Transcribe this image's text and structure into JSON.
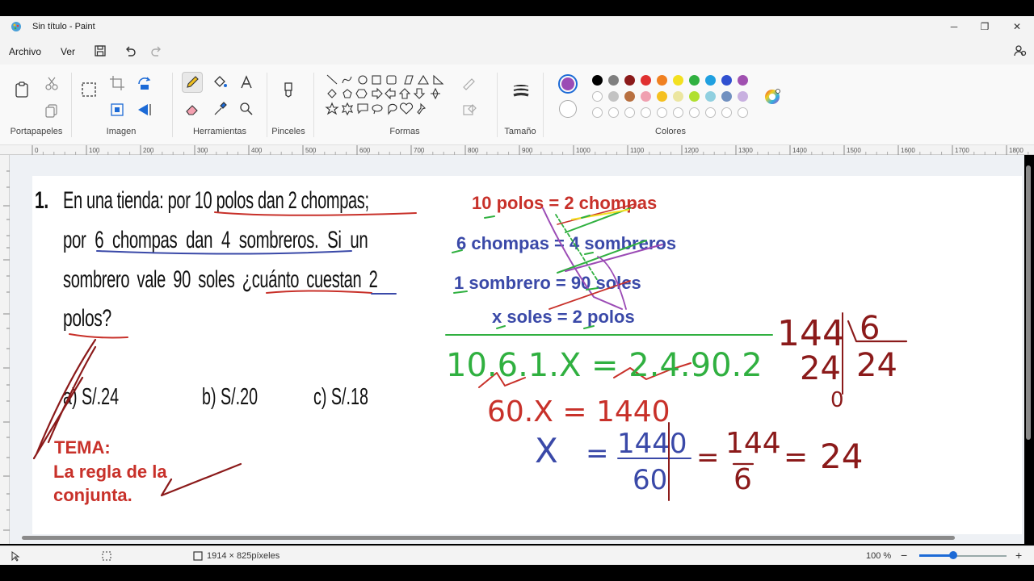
{
  "window": {
    "title": "Sin título - Paint"
  },
  "menu": {
    "file": "Archivo",
    "view": "Ver"
  },
  "ribbon": {
    "groups": [
      "Portapapeles",
      "Imagen",
      "Herramientas",
      "Pinceles",
      "Formas",
      "Tamaño",
      "Colores"
    ]
  },
  "colors": {
    "primary": "#9b4bb5",
    "palette_row1": [
      "#000000",
      "#7f7f7f",
      "#8b1a1a",
      "#e03030",
      "#f08020",
      "#f3e020",
      "#30b040",
      "#20a0e0",
      "#3050d0",
      "#a050b0"
    ],
    "palette_row2": [
      "#ffffff",
      "#c3c3c3",
      "#b87040",
      "#f0a0b0",
      "#f5c020",
      "#ece6a0",
      "#b0e030",
      "#90d0e0",
      "#7090c0",
      "#c8b0e0"
    ]
  },
  "ruler": {
    "ticks": [
      "0",
      "100",
      "200",
      "300",
      "400",
      "500",
      "600",
      "700",
      "800",
      "900",
      "1000",
      "1100",
      "1200",
      "1300",
      "1400",
      "1500",
      "1600",
      "1700",
      "1800"
    ]
  },
  "problem": {
    "number": "1.",
    "line1": "En una tienda: por 10 polos dan 2 chompas;",
    "line2": "por 6 chompas dan 4 sombreros. Si un",
    "line3": "sombrero vale 90 soles ¿cuánto cuestan 2",
    "line4": "polos?",
    "option_a": "a) S/.24",
    "option_b": "b) S/.20",
    "option_c": "c) S/.18"
  },
  "tema": {
    "line1": "TEMA:",
    "line2": "La regla de la",
    "line3": "conjunta."
  },
  "equations": {
    "eq1": "10 polos = 2 chompas",
    "eq2": "6 chompas = 4 sombreros",
    "eq3": "1 sombrero = 90 soles",
    "eq4": "x soles = 2 polos"
  },
  "handwritten": {
    "product": "10.6.1.X = 2.4.90.2",
    "step2": "60.X = 1440",
    "x": "X",
    "eq_sign": "=",
    "numerator": "1440",
    "denominator": "60",
    "num2": "144",
    "den2": "6",
    "result": "24",
    "div_dividend": "144",
    "div_divisor": "6",
    "div_quotient": "24",
    "div_sub": "24",
    "div_rest": "0"
  },
  "status": {
    "dimensions": "1914 × 825píxeles",
    "zoom": "100 %"
  }
}
